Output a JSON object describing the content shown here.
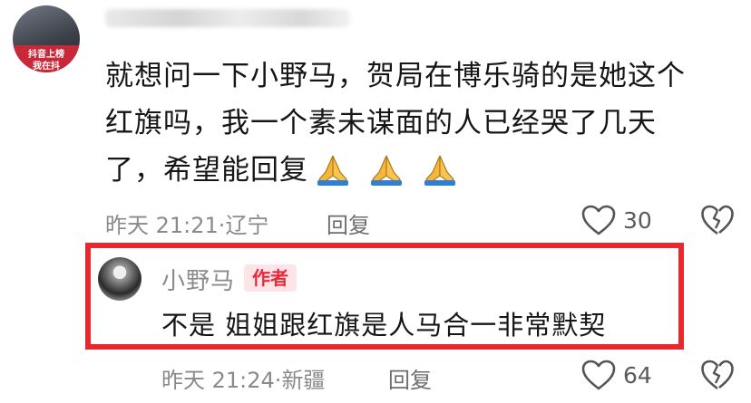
{
  "comment": {
    "avatar_text_1": "抖音上榜",
    "avatar_text_2": "我在抖",
    "text_line_1": "就想问一下小野马，贺局在博乐骑的是她这个",
    "text_line_2": "红旗吗，我一个素未谋面的人已经哭了几天",
    "text_line_3": "了，希望能回复",
    "emoji": [
      "folded-hands",
      "folded-hands",
      "folded-hands"
    ],
    "time": "昨天 21:21",
    "location": "辽宁",
    "separator": "·",
    "reply_label": "回复",
    "like_count": "30"
  },
  "reply": {
    "username": "小野马",
    "badge": "作者",
    "text": "不是 姐姐跟红旗是人马合一非常默契",
    "time": "昨天 21:24",
    "location": "新疆",
    "separator": "·",
    "reply_label": "回复",
    "like_count": "64"
  },
  "colors": {
    "highlight_border": "#e8282f",
    "badge_bg": "#fde4e6",
    "badge_text": "#e8283a",
    "meta_text": "#8a8a8a"
  }
}
